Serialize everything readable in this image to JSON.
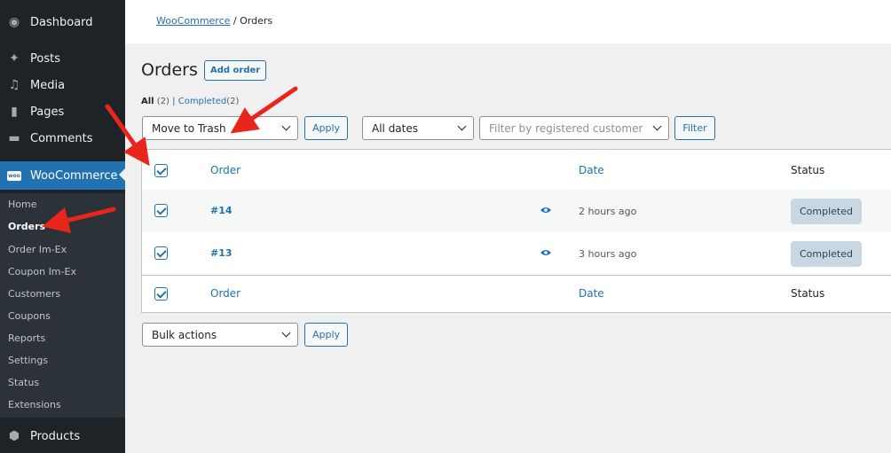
{
  "sidebar": {
    "items": [
      {
        "label": "Dashboard",
        "icon": "dashboard-icon"
      },
      {
        "label": "Posts",
        "icon": "pin-icon"
      },
      {
        "label": "Media",
        "icon": "media-icon"
      },
      {
        "label": "Pages",
        "icon": "pages-icon"
      },
      {
        "label": "Comments",
        "icon": "comments-icon"
      },
      {
        "label": "WooCommerce",
        "icon": "woo-icon",
        "badge": "woo"
      },
      {
        "label": "Products",
        "icon": "products-icon"
      }
    ],
    "submenu": [
      "Home",
      "Orders",
      "Order Im-Ex",
      "Coupon Im-Ex",
      "Customers",
      "Coupons",
      "Reports",
      "Settings",
      "Status",
      "Extensions"
    ]
  },
  "breadcrumb": {
    "link": "WooCommerce",
    "separator": " / ",
    "current": "Orders"
  },
  "page": {
    "title": "Orders",
    "add_button": "Add order"
  },
  "filters": {
    "all_label": "All",
    "all_count": "(2)",
    "sep": "|",
    "completed_label": "Completed",
    "completed_count": "(2)"
  },
  "toolbar_top": {
    "bulk_selected": "Move to Trash",
    "apply": "Apply",
    "dates": "All dates",
    "customer_placeholder": "Filter by registered customer",
    "filter": "Filter"
  },
  "table": {
    "columns": {
      "order": "Order",
      "date": "Date",
      "status": "Status"
    },
    "rows": [
      {
        "order": "#14",
        "date": "2 hours ago",
        "status": "Completed"
      },
      {
        "order": "#13",
        "date": "3 hours ago",
        "status": "Completed"
      }
    ]
  },
  "toolbar_bottom": {
    "bulk_selected": "Bulk actions",
    "apply": "Apply"
  },
  "colors": {
    "accent": "#2271b1",
    "sidebar": "#1d2327",
    "annotation": "#e8261c",
    "badge": "#c8d7e1"
  }
}
